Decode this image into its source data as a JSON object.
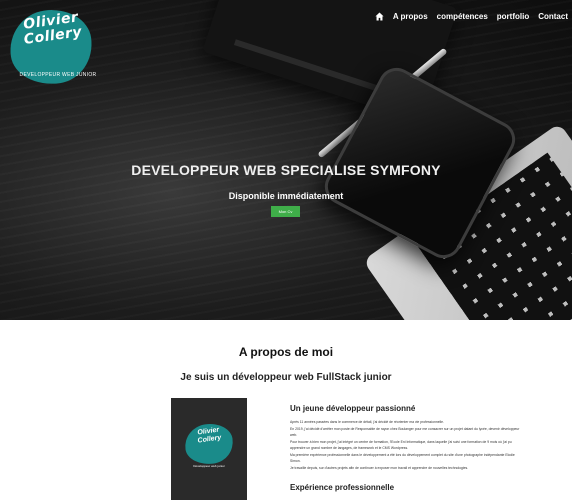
{
  "logo": {
    "name_line1": "Olivier",
    "name_line2": "Collery",
    "tagline": "DEVELOPPEUR WEB JUNIOR"
  },
  "nav": {
    "home_icon": "home-icon",
    "items": [
      "A propos",
      "compétences",
      "portfolio",
      "Contact"
    ]
  },
  "hero": {
    "title": "DEVELOPPEUR WEB SPECIALISE SYMFONY",
    "subtitle": "Disponible immédiatement",
    "button_label": "Mon Cv"
  },
  "about": {
    "title": "A propos de moi",
    "subtitle": "Je suis un développeur web FullStack junior",
    "card": {
      "name_line1": "Olivier",
      "name_line2": "Collery",
      "tagline": "Développeur web junior"
    },
    "section1_heading": "Un jeune développeur passionné",
    "paragraphs": [
      "Après 11 années passées dans le commerce de détail, j'ai décidé de réorienter ma vie professionnelle.",
      "En 2019, j'ai décidé d'arrêter mon poste de Responsable de rayon chez Boulanger pour me consacrer sur un projet datant du lycée, devenir développeur web.",
      "Pour trouver à bien mon projet, j'ai intégré un centre de formation, l'Ecole Eni Informatique, dans laquelle j'ai suivi une formation de 9 mois où j'ai pu apprendre un grand nombre de langages, de framework et le CMS Wordpress.",
      "Ma première expérience professionnelle dans le développement a été lors du développement complet du site d'une photographe indépendante Elodie Simon.",
      "Je travaille depuis, sur d'autres projets afin de continuer à exposer mon travail et apprendre de nouvelles technologies."
    ],
    "section2_heading": "Expérience professionnelle"
  },
  "colors": {
    "accent_teal": "#1a8b8a",
    "button_green": "#3fae49"
  }
}
